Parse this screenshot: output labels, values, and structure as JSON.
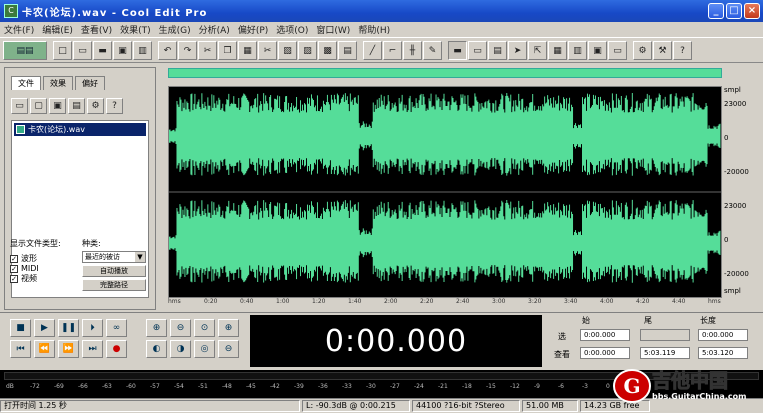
{
  "window": {
    "title": "卡农(论坛).wav - Cool Edit Pro"
  },
  "menu": [
    "文件(F)",
    "编辑(E)",
    "查看(V)",
    "效果(T)",
    "生成(G)",
    "分析(A)",
    "偏好(P)",
    "选项(O)",
    "窗口(W)",
    "帮助(H)"
  ],
  "left": {
    "tabs": [
      "文件",
      "效果",
      "偏好"
    ],
    "file_name": "卡农(论坛).wav",
    "show_label": "显示文件类型:",
    "sort_label": "种类:",
    "types": [
      "波形",
      "MIDI",
      "视频"
    ],
    "sort_value": "最近的被访",
    "btn_auto": "自动播放",
    "btn_full": "完整路径"
  },
  "wave": {
    "ruler_right": [
      "smpl",
      "23000",
      "0",
      "-20000",
      "23000",
      "0",
      "-20000",
      "smpl"
    ],
    "time_ticks": [
      "hms",
      "0:20",
      "0:40",
      "1:00",
      "1:20",
      "1:40",
      "2:00",
      "2:20",
      "2:40",
      "3:00",
      "3:20",
      "3:40",
      "4:00",
      "4:20",
      "4:40",
      "hms"
    ]
  },
  "transport": {
    "time": "0:00.000"
  },
  "selection": {
    "hdr_start": "始",
    "hdr_end": "尾",
    "hdr_len": "长度",
    "row1_label": "选",
    "row2_label": "查看",
    "sel_start": "0:00.000",
    "sel_end": "",
    "sel_len": "0:00.000",
    "view_start": "0:00.000",
    "view_end": "5:03.119",
    "view_len": "5:03.120"
  },
  "levels": {
    "ticks": [
      "dB",
      "-72",
      "-69",
      "-66",
      "-63",
      "-60",
      "-57",
      "-54",
      "-51",
      "-48",
      "-45",
      "-42",
      "-39",
      "-36",
      "-33",
      "-30",
      "-27",
      "-24",
      "-21",
      "-18",
      "-15",
      "-12",
      "-9",
      "-6",
      "-3",
      "0"
    ]
  },
  "status": {
    "left": "打开时间 1.25 秒",
    "db": "L: -90.3dB @ 0:00.215",
    "format": "44100 ?16-bit ?Stereo",
    "size": "51.00 MB",
    "free": "14.23 GB free"
  },
  "watermark": {
    "cn": "吉他中国",
    "url": "bbs.GuitarChina.com"
  },
  "colors": {
    "wave": "#55dd99",
    "bg": "#000000",
    "title": "#1f55d6"
  }
}
